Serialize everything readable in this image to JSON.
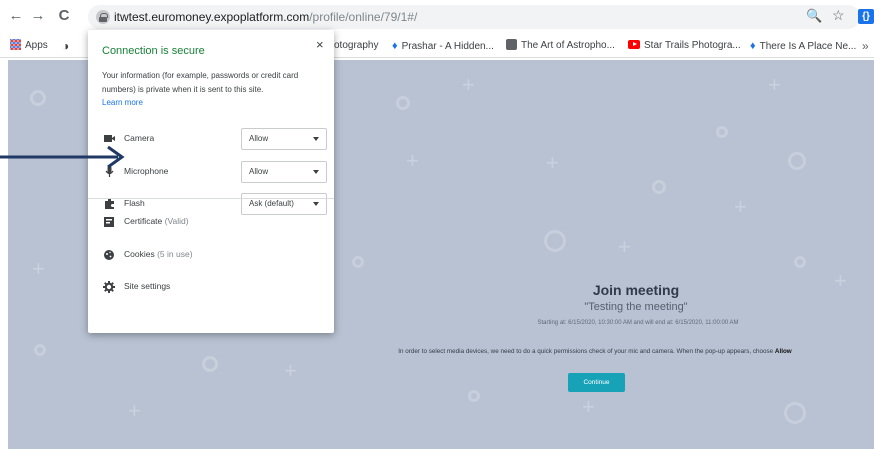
{
  "browser": {
    "url_host": "itwtest.euromoney.expoplatform.com",
    "url_path": "/profile/online/79/1#/",
    "back_glyph": "←",
    "forward_glyph": "→",
    "reload_glyph": "C",
    "zoom_glyph": "🔍",
    "star_glyph": "☆",
    "extension_glyph": "{}"
  },
  "bookmarks": [
    {
      "label": "Apps",
      "icon": "apps-grid-icon"
    },
    {
      "label": "otography",
      "icon": ""
    },
    {
      "label": "Prashar - A Hidden...",
      "icon": "map-pin-icon"
    },
    {
      "label": "The Art of Astropho...",
      "icon": "page-icon"
    },
    {
      "label": "Star Trails Photogra...",
      "icon": "youtube-icon"
    },
    {
      "label": "There Is A Place Ne...",
      "icon": "map-pin-icon"
    }
  ],
  "site_info": {
    "title": "Connection is secure",
    "close_glyph": "×",
    "description": "Your information (for example, passwords or credit card numbers) is private when it is sent to this site.",
    "learn_more": "Learn more",
    "permissions": [
      {
        "label": "Camera",
        "value": "Allow",
        "icon": "camera-icon"
      },
      {
        "label": "Microphone",
        "value": "Allow",
        "icon": "microphone-icon"
      },
      {
        "label": "Flash",
        "value": "Ask (default)",
        "icon": "puzzle-icon"
      }
    ],
    "certificate_label": "Certificate",
    "certificate_status": "(Valid)",
    "cookies_label": "Cookies",
    "cookies_status": "(5 in use)",
    "site_settings_label": "Site settings"
  },
  "meeting": {
    "title": "Join meeting",
    "subtitle": "\"Testing the meeting\"",
    "time_text": "Starting at: 6/15/2020, 10:30:00 AM     and will end at: 6/15/2020, 11:00:00 AM",
    "message_prefix": "In order to select media devices, we need to do a quick permissions check of your mic and camera. When the pop-up appears, choose",
    "message_bold": "Allow",
    "continue_label": "Continue"
  },
  "colors": {
    "page_background": "#b8c2d2",
    "secure_green": "#188038",
    "link_blue": "#1a73e8",
    "continue_button": "#17a2b8",
    "annotation_arrow": "#1f3864"
  }
}
